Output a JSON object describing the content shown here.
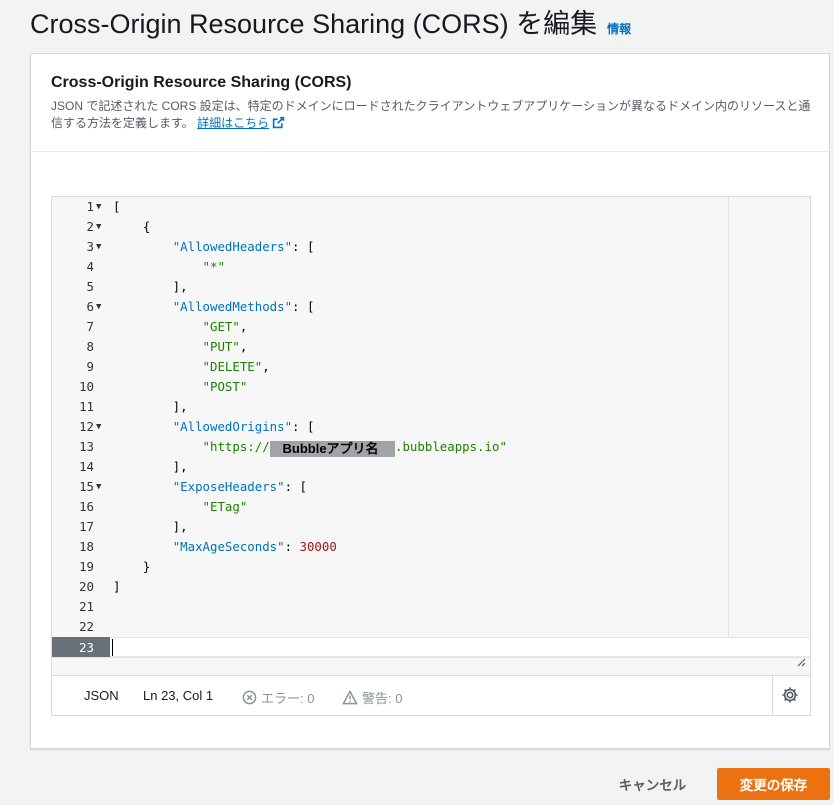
{
  "page": {
    "title": "Cross-Origin Resource Sharing (CORS) を編集",
    "info_link": "情報"
  },
  "panel": {
    "title": "Cross-Origin Resource Sharing (CORS)",
    "description": "JSON で記述された CORS 設定は、特定のドメインにロードされたクライアントウェブアプリケーションが異なるドメイン内のリソースと通信する方法を定義します。",
    "learn_more": "詳細はこちら"
  },
  "editor": {
    "lines": [
      {
        "n": "1",
        "fold": true,
        "tokens": [
          {
            "t": "[",
            "c": "punc"
          }
        ]
      },
      {
        "n": "2",
        "fold": true,
        "tokens": [
          {
            "t": "    {",
            "c": "punc"
          }
        ]
      },
      {
        "n": "3",
        "fold": true,
        "tokens": [
          {
            "t": "        ",
            "c": "punc"
          },
          {
            "t": "\"AllowedHeaders\"",
            "c": "key"
          },
          {
            "t": ": [",
            "c": "punc"
          }
        ]
      },
      {
        "n": "4",
        "fold": false,
        "tokens": [
          {
            "t": "            ",
            "c": "punc"
          },
          {
            "t": "\"*\"",
            "c": "str"
          }
        ]
      },
      {
        "n": "5",
        "fold": false,
        "tokens": [
          {
            "t": "        ],",
            "c": "punc"
          }
        ]
      },
      {
        "n": "6",
        "fold": true,
        "tokens": [
          {
            "t": "        ",
            "c": "punc"
          },
          {
            "t": "\"AllowedMethods\"",
            "c": "key"
          },
          {
            "t": ": [",
            "c": "punc"
          }
        ]
      },
      {
        "n": "7",
        "fold": false,
        "tokens": [
          {
            "t": "            ",
            "c": "punc"
          },
          {
            "t": "\"GET\"",
            "c": "str"
          },
          {
            "t": ",",
            "c": "punc"
          }
        ]
      },
      {
        "n": "8",
        "fold": false,
        "tokens": [
          {
            "t": "            ",
            "c": "punc"
          },
          {
            "t": "\"PUT\"",
            "c": "str"
          },
          {
            "t": ",",
            "c": "punc"
          }
        ]
      },
      {
        "n": "9",
        "fold": false,
        "tokens": [
          {
            "t": "            ",
            "c": "punc"
          },
          {
            "t": "\"DELETE\"",
            "c": "str"
          },
          {
            "t": ",",
            "c": "punc"
          }
        ]
      },
      {
        "n": "10",
        "fold": false,
        "tokens": [
          {
            "t": "            ",
            "c": "punc"
          },
          {
            "t": "\"POST\"",
            "c": "str"
          }
        ]
      },
      {
        "n": "11",
        "fold": false,
        "tokens": [
          {
            "t": "        ],",
            "c": "punc"
          }
        ]
      },
      {
        "n": "12",
        "fold": true,
        "tokens": [
          {
            "t": "        ",
            "c": "punc"
          },
          {
            "t": "\"AllowedOrigins\"",
            "c": "key"
          },
          {
            "t": ": [",
            "c": "punc"
          }
        ]
      },
      {
        "n": "13",
        "fold": false,
        "tokens": [
          {
            "t": "            ",
            "c": "punc"
          },
          {
            "t": "\"https://",
            "c": "str"
          },
          {
            "t": "   Bubbleアプリ名    ",
            "c": "redact"
          },
          {
            "t": ".bubbleapps.io\"",
            "c": "str"
          }
        ]
      },
      {
        "n": "14",
        "fold": false,
        "tokens": [
          {
            "t": "        ],",
            "c": "punc"
          }
        ]
      },
      {
        "n": "15",
        "fold": true,
        "tokens": [
          {
            "t": "        ",
            "c": "punc"
          },
          {
            "t": "\"ExposeHeaders\"",
            "c": "key"
          },
          {
            "t": ": [",
            "c": "punc"
          }
        ]
      },
      {
        "n": "16",
        "fold": false,
        "tokens": [
          {
            "t": "            ",
            "c": "punc"
          },
          {
            "t": "\"ETag\"",
            "c": "str"
          }
        ]
      },
      {
        "n": "17",
        "fold": false,
        "tokens": [
          {
            "t": "        ],",
            "c": "punc"
          }
        ]
      },
      {
        "n": "18",
        "fold": false,
        "tokens": [
          {
            "t": "        ",
            "c": "punc"
          },
          {
            "t": "\"MaxAgeSeconds\"",
            "c": "key"
          },
          {
            "t": ": ",
            "c": "punc"
          },
          {
            "t": "30000",
            "c": "num"
          }
        ]
      },
      {
        "n": "19",
        "fold": false,
        "tokens": [
          {
            "t": "    }",
            "c": "punc"
          }
        ]
      },
      {
        "n": "20",
        "fold": false,
        "tokens": [
          {
            "t": "]",
            "c": "punc"
          }
        ]
      },
      {
        "n": "21",
        "fold": false,
        "tokens": []
      },
      {
        "n": "22",
        "fold": false,
        "tokens": []
      },
      {
        "n": "23",
        "fold": false,
        "active": true,
        "tokens": []
      }
    ],
    "status": {
      "mode": "JSON",
      "position": "Ln 23, Col 1",
      "errors": "エラー: 0",
      "warnings": "警告: 0"
    }
  },
  "actions": {
    "cancel": "キャンセル",
    "save": "変更の保存"
  },
  "colors": {
    "primary_button": "#ec7211",
    "link": "#0073bb",
    "json_key": "#0073bb",
    "json_string": "#1d8102",
    "json_number": "#a31515"
  }
}
